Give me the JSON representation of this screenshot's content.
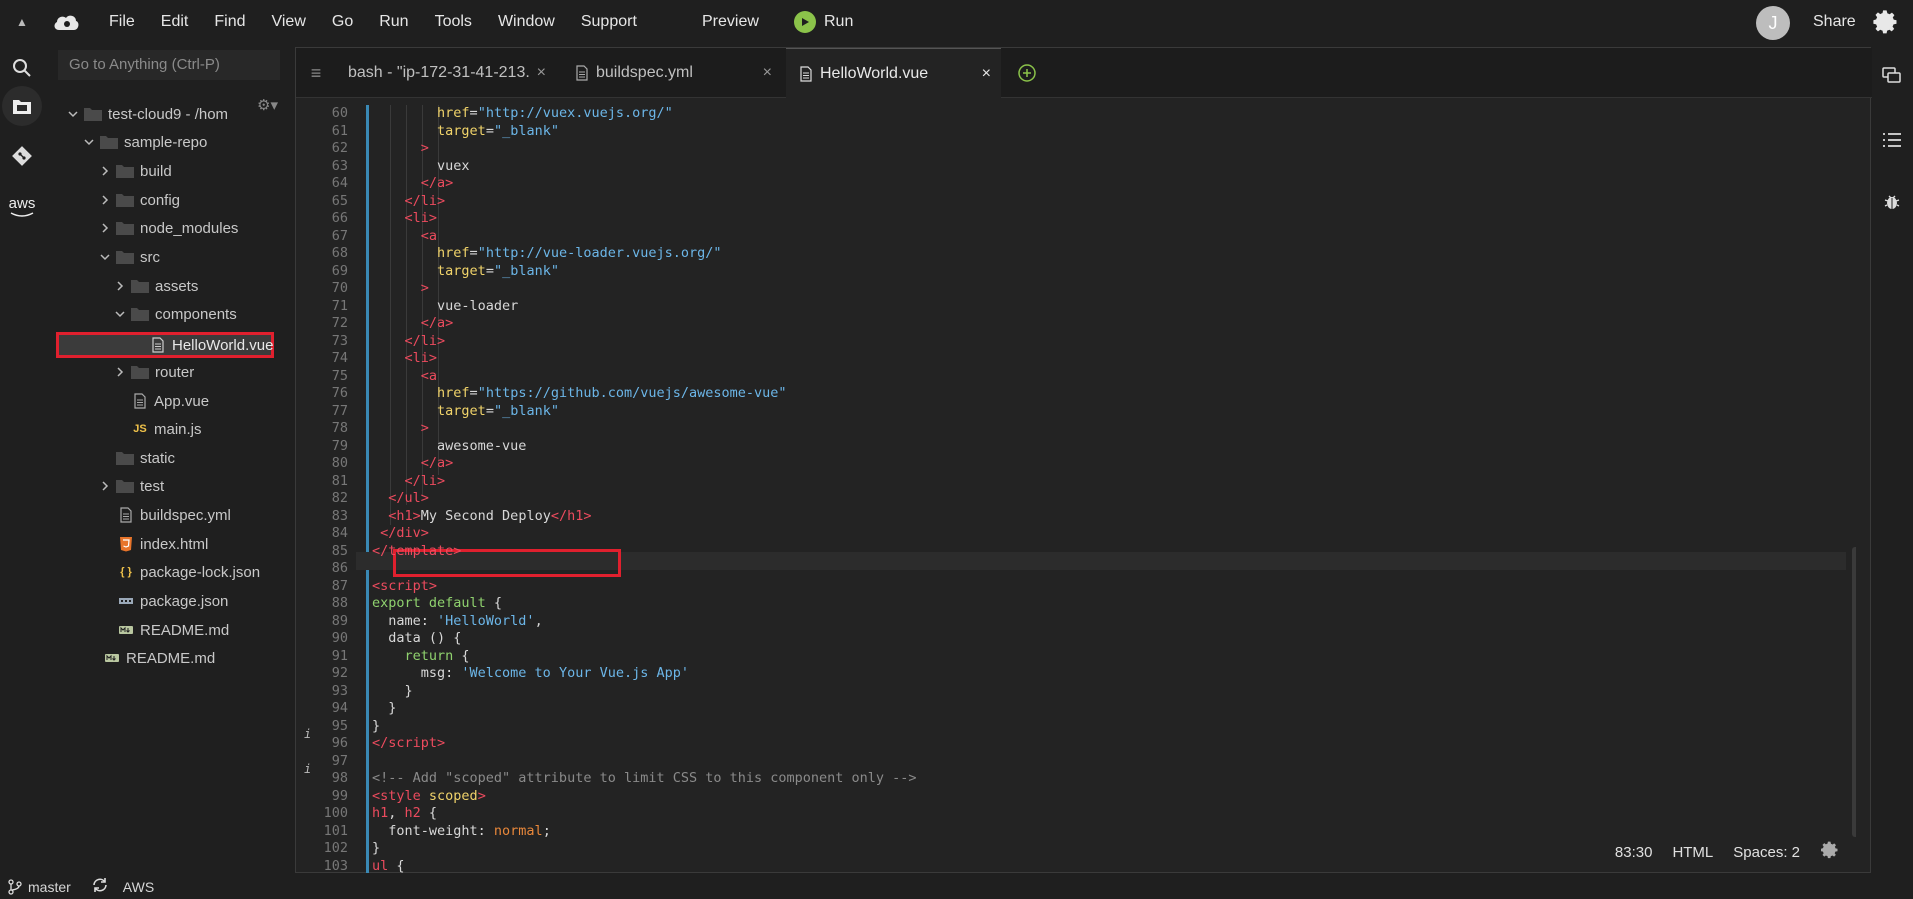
{
  "menubar": {
    "items": [
      "File",
      "Edit",
      "Find",
      "View",
      "Go",
      "Run",
      "Tools",
      "Window",
      "Support"
    ],
    "preview_label": "Preview",
    "run_label": "Run",
    "avatar_initial": "J",
    "share_label": "Share"
  },
  "tree": {
    "goto_placeholder": "Go to Anything (Ctrl-P)",
    "items": [
      {
        "label": "test-cloud9 - /hom",
        "type": "folder-open"
      },
      {
        "label": "sample-repo",
        "type": "folder-open"
      },
      {
        "label": "build",
        "type": "folder-closed"
      },
      {
        "label": "config",
        "type": "folder-closed"
      },
      {
        "label": "node_modules",
        "type": "folder-closed"
      },
      {
        "label": "src",
        "type": "folder-open"
      },
      {
        "label": "assets",
        "type": "folder-closed"
      },
      {
        "label": "components",
        "type": "folder-open"
      },
      {
        "label": "HelloWorld.vue",
        "type": "file"
      },
      {
        "label": "router",
        "type": "folder-closed"
      },
      {
        "label": "App.vue",
        "type": "file"
      },
      {
        "label": "main.js",
        "type": "js"
      },
      {
        "label": "static",
        "type": "folder"
      },
      {
        "label": "test",
        "type": "folder-closed"
      },
      {
        "label": "buildspec.yml",
        "type": "file"
      },
      {
        "label": "index.html",
        "type": "html"
      },
      {
        "label": "package-lock.json",
        "type": "json"
      },
      {
        "label": "package.json",
        "type": "pkg"
      },
      {
        "label": "README.md",
        "type": "md"
      },
      {
        "label": "README.md",
        "type": "md"
      }
    ],
    "js_glyph": "JS",
    "json_glyph": "{ }"
  },
  "tabs": [
    {
      "label": "bash - \"ip-172-31-41-213.",
      "close": "×"
    },
    {
      "label": "buildspec.yml",
      "close": "×"
    },
    {
      "label": "HelloWorld.vue",
      "close": "×"
    }
  ],
  "status": {
    "cursor": "83:30",
    "mode": "HTML",
    "indent": "Spaces: 2"
  },
  "bottombar": {
    "branch": "master",
    "aws": "AWS"
  },
  "colors": {
    "background": "#1f1f1f",
    "editor": "#232323",
    "highlight_box": "#e0202e",
    "tag": "#ec4b5e",
    "attribute": "#f0d36a",
    "string": "#6cb6e8",
    "keyword": "#8fd16e"
  },
  "icons": {
    "left_bar": [
      "search-icon",
      "files-icon",
      "git-icon",
      "aws-icon"
    ],
    "right_bar": [
      "chat-icon",
      "outline-icon",
      "debug-icon"
    ],
    "aws_label": "aws"
  },
  "code": {
    "line_numbers": [
      "60",
      "61",
      "62",
      "63",
      "64",
      "65",
      "66",
      "67",
      "68",
      "69",
      "70",
      "71",
      "72",
      "73",
      "74",
      "75",
      "76",
      "77",
      "78",
      "79",
      "80",
      "81",
      "82",
      "83",
      "84",
      "85",
      "86",
      "87",
      "88",
      "89",
      "90",
      "91",
      "92",
      "93",
      "94",
      "95",
      "96",
      "97",
      "98",
      "99",
      "100",
      "101",
      "102",
      "103"
    ]
  }
}
